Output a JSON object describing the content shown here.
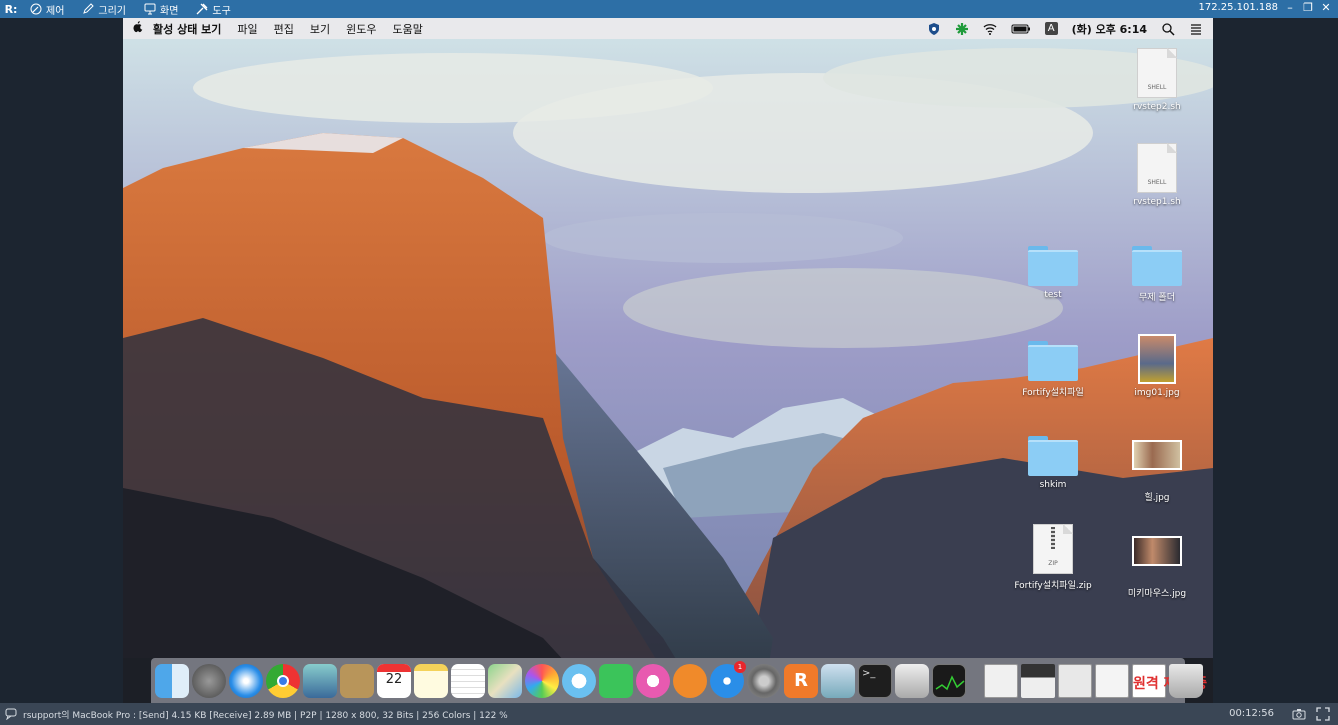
{
  "viewer": {
    "logo": "R:",
    "menu": [
      {
        "label": "제어",
        "icon": "pen-icon"
      },
      {
        "label": "그리기",
        "icon": "pencil-icon"
      },
      {
        "label": "화면",
        "icon": "monitor-icon"
      },
      {
        "label": "도구",
        "icon": "tools-icon"
      }
    ],
    "ip": "172.25.101.188",
    "status": "rsupport의 MacBook Pro : [Send] 4.15 KB  [Receive] 2.89 MB | P2P | 1280 x 800, 32 Bits | 256 Colors | 122 %",
    "time": "00:12:56"
  },
  "mac": {
    "menubar": {
      "apple": "",
      "app": "활성 상태 보기",
      "menus": [
        "파일",
        "편집",
        "보기",
        "윈도우",
        "도움말"
      ],
      "input_source": "A",
      "clock": "(화) 오후 6:14"
    },
    "desktop_icons": [
      {
        "label": "rvstep2.sh",
        "type": "doc",
        "ext": "SHELL"
      },
      {
        "label": "rvstep1.sh",
        "type": "doc",
        "ext": "SHELL"
      },
      {
        "label": "test",
        "type": "folder"
      },
      {
        "label": "무제 폴더",
        "type": "folder"
      },
      {
        "label": "Fortify설치파일",
        "type": "folder"
      },
      {
        "label": "img01.jpg",
        "type": "photo"
      },
      {
        "label": "shkim",
        "type": "folder"
      },
      {
        "label": "힐.jpg",
        "type": "photo"
      },
      {
        "label": "Fortify설치파일.zip",
        "type": "zip",
        "ext": "ZIP"
      },
      {
        "label": "미키마우스.jpg",
        "type": "photo"
      }
    ],
    "dock": {
      "calendar_day": "22",
      "appstore_badge": "1",
      "overlay_text": "원격 제어 중"
    }
  }
}
